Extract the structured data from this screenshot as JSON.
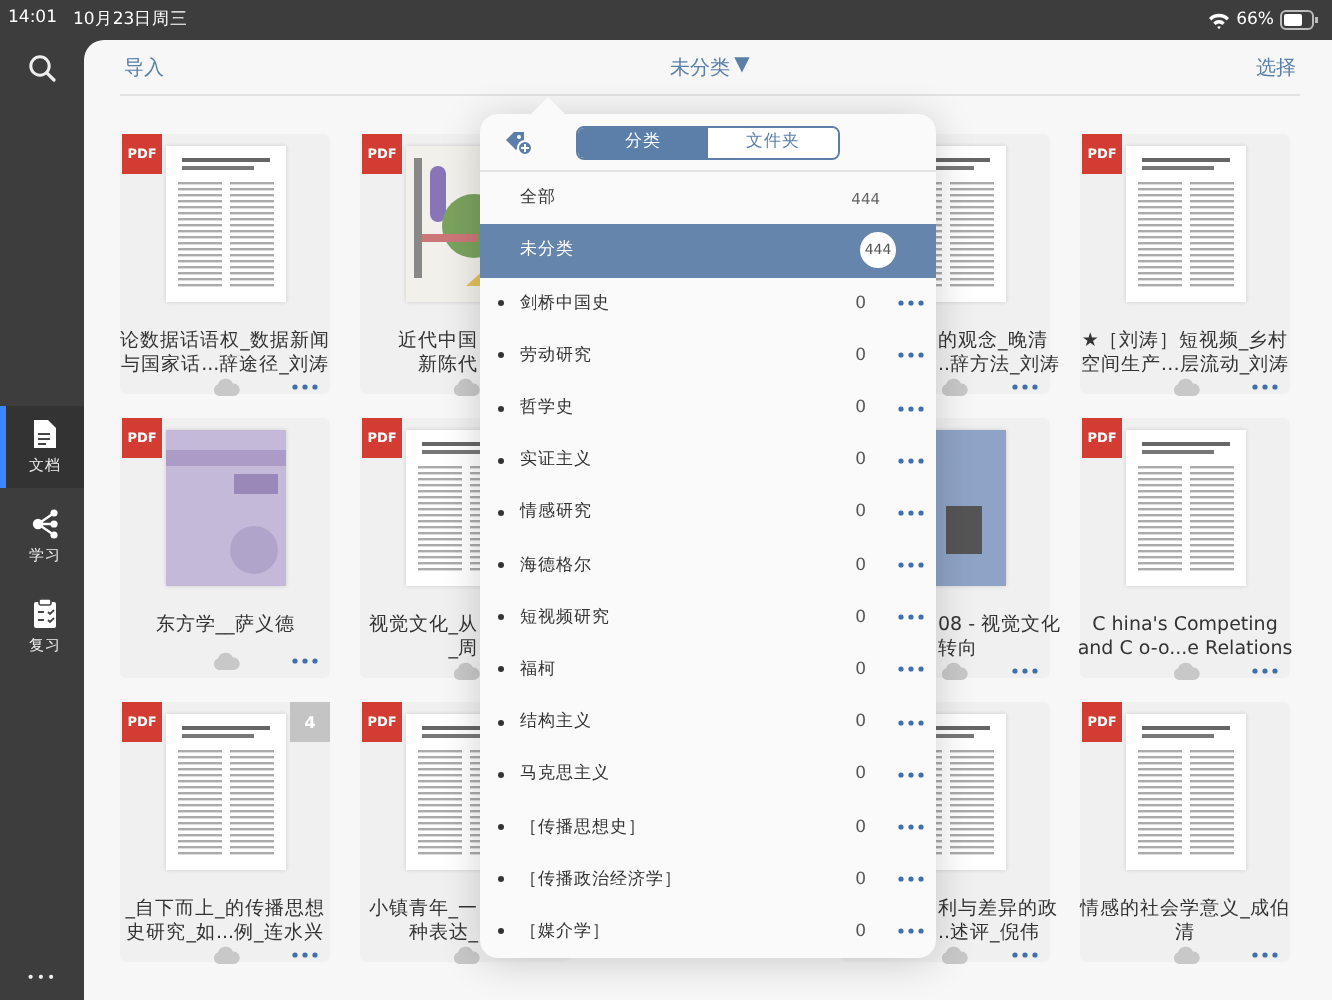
{
  "status_bar": {
    "time": "14:01",
    "date": "10月23日周三",
    "battery": "66%"
  },
  "sidebar": {
    "items": [
      {
        "kind": "document",
        "label": "文档",
        "selected": true
      },
      {
        "kind": "share",
        "label": "学习",
        "selected": false
      },
      {
        "kind": "clipboard",
        "label": "复习",
        "selected": false
      }
    ],
    "more": "•••"
  },
  "header": {
    "left": "导入",
    "title": "未分类",
    "title_caret": "▼",
    "right": "选择"
  },
  "cards": [
    {
      "kind": "full",
      "badge": "PDF",
      "thumb": {
        "kind": "page"
      },
      "title_lines": [
        "论数据话语权_数据新闻",
        "与国家话...辞途径_刘涛"
      ]
    },
    {
      "kind": "left-part",
      "badge": "PDF",
      "thumb": {
        "kind": "art-cover"
      },
      "title_lines": [
        "近代中国",
        "新陈代"
      ]
    },
    {
      "kind": "right-part",
      "thumb": {
        "kind": "page"
      },
      "title_lines": [
        "的观念_晚清",
        "..辞方法_刘涛"
      ]
    },
    {
      "kind": "full",
      "badge": "PDF",
      "thumb": {
        "kind": "page"
      },
      "title_lines": [
        "★［刘涛］短视频_乡村",
        "空间生产…层流动_刘涛"
      ]
    },
    {
      "kind": "full",
      "badge": "PDF",
      "thumb": {
        "kind": "purple-cover"
      },
      "title_lines": [
        "东方学__萨义德"
      ]
    },
    {
      "kind": "left-part",
      "badge": "PDF",
      "thumb": {
        "kind": "page"
      },
      "title_lines": [
        "视觉文化_从",
        "_周"
      ]
    },
    {
      "kind": "right-part",
      "thumb": {
        "kind": "blue-cover"
      },
      "title_lines": [
        "08 - 视觉文化",
        "转向"
      ]
    },
    {
      "kind": "full",
      "badge": "PDF",
      "thumb": {
        "kind": "page"
      },
      "title_lines": [
        "C hina's Competing",
        "and C o-o...e Relations"
      ]
    },
    {
      "kind": "full",
      "badge": "PDF",
      "count": "4",
      "thumb": {
        "kind": "page"
      },
      "title_lines": [
        "_自下而上_的传播思想",
        "史研究_如...例_连水兴"
      ]
    },
    {
      "kind": "left-part",
      "badge": "PDF",
      "thumb": {
        "kind": "page"
      },
      "title_lines": [
        "小镇青年_一",
        "种表达_"
      ]
    },
    {
      "kind": "right-part",
      "thumb": {
        "kind": "page"
      },
      "title_lines": [
        "利与差异的政",
        "..述评_倪伟"
      ]
    },
    {
      "kind": "full",
      "badge": "PDF",
      "thumb": {
        "kind": "page"
      },
      "title_lines": [
        "情感的社会学意义_成伯",
        "清"
      ]
    }
  ],
  "popover": {
    "segments": [
      {
        "label": "分类",
        "selected": true
      },
      {
        "label": "文件夹",
        "selected": false
      }
    ],
    "items": [
      {
        "kind": "top",
        "name": "全部",
        "count": "444",
        "selected": false
      },
      {
        "kind": "top",
        "name": "未分类",
        "count": "444",
        "selected": true
      },
      {
        "kind": "tag",
        "name": "剑桥中国史",
        "count": "0",
        "selected": false
      },
      {
        "kind": "tag",
        "name": "劳动研究",
        "count": "0",
        "selected": false
      },
      {
        "kind": "tag",
        "name": "哲学史",
        "count": "0",
        "selected": false
      },
      {
        "kind": "tag",
        "name": "实证主义",
        "count": "0",
        "selected": false
      },
      {
        "kind": "tag",
        "name": "情感研究",
        "count": "0",
        "selected": false
      },
      {
        "kind": "tag",
        "name": "海德格尔",
        "count": "0",
        "selected": false
      },
      {
        "kind": "tag",
        "name": "短视频研究",
        "count": "0",
        "selected": false
      },
      {
        "kind": "tag",
        "name": "福柯",
        "count": "0",
        "selected": false
      },
      {
        "kind": "tag",
        "name": "结构主义",
        "count": "0",
        "selected": false
      },
      {
        "kind": "tag",
        "name": "马克思主义",
        "count": "0",
        "selected": false
      },
      {
        "kind": "tag",
        "name": "［传播思想史］",
        "count": "0",
        "selected": false
      },
      {
        "kind": "tag",
        "name": "［传播政治经济学］",
        "count": "0",
        "selected": false
      },
      {
        "kind": "tag",
        "name": "［媒介学］",
        "count": "0",
        "selected": false
      }
    ]
  }
}
